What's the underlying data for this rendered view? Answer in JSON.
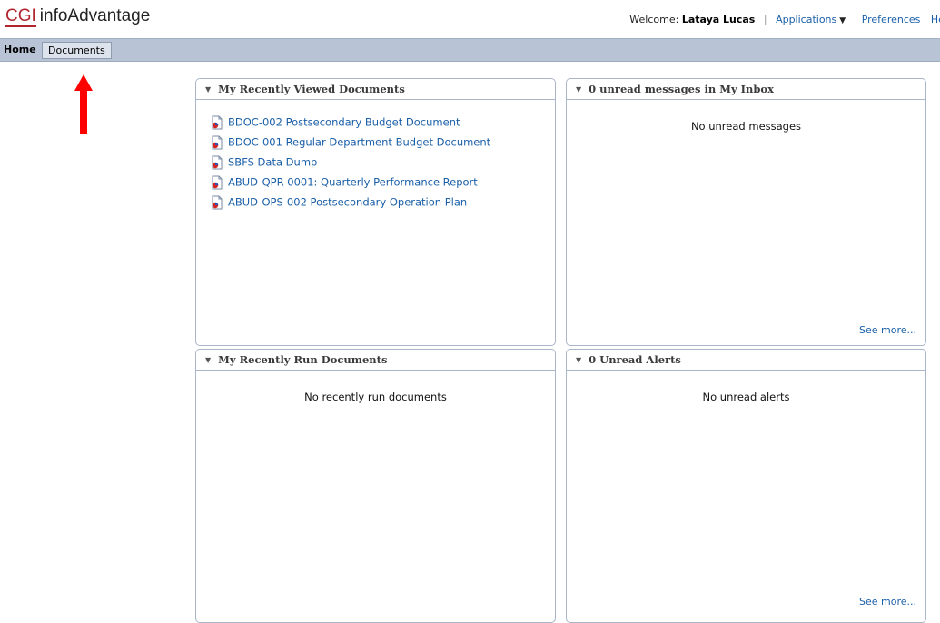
{
  "header": {
    "logo_mark": "CGI",
    "logo_name": "infoAdvantage",
    "welcome_label": "Welcome:",
    "user_name": "Lataya Lucas",
    "separator": "|",
    "menu": {
      "applications": "Applications",
      "preferences": "Preferences",
      "help": "Hel"
    }
  },
  "tabs": [
    {
      "label": "Home",
      "active": true
    },
    {
      "label": "Documents",
      "active": false
    }
  ],
  "panels": {
    "recently_viewed": {
      "title": "My Recently Viewed Documents",
      "documents": [
        "BDOC-002 Postsecondary Budget Document",
        "BDOC-001 Regular Department Budget Document",
        "SBFS Data Dump",
        "ABUD-QPR-0001: Quarterly Performance Report",
        "ABUD-OPS-002 Postsecondary Operation Plan"
      ]
    },
    "inbox": {
      "title": "0 unread messages in My Inbox",
      "empty_text": "No unread messages",
      "see_more": "See more..."
    },
    "recently_run": {
      "title": "My Recently Run Documents",
      "empty_text": "No recently run documents"
    },
    "alerts": {
      "title": "0 Unread Alerts",
      "empty_text": "No unread alerts",
      "see_more": "See more..."
    }
  },
  "colors": {
    "link": "#1a5fa8",
    "brand": "#b0252e",
    "tabbar": "#b8c4d6",
    "annotation_arrow": "#ff0000"
  }
}
